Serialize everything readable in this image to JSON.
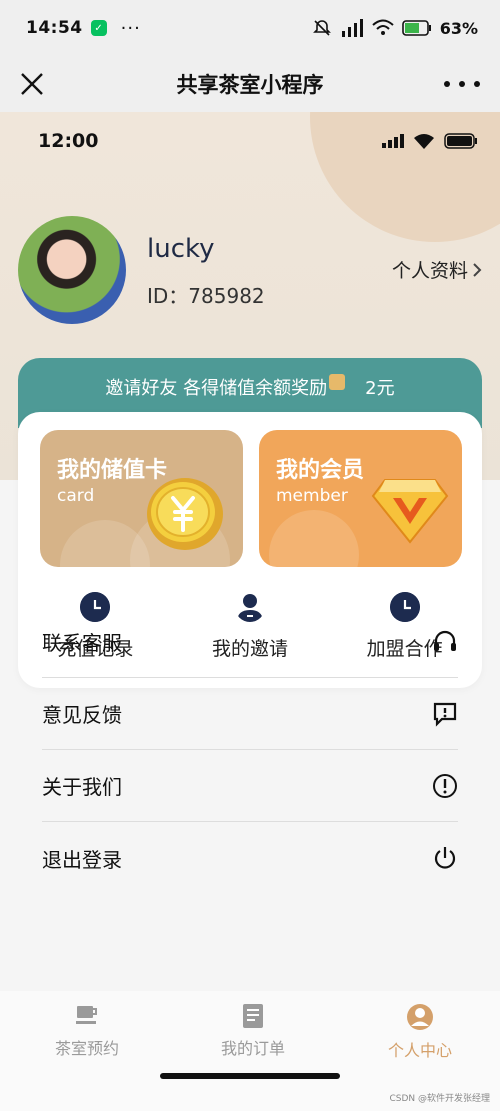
{
  "status_bar": {
    "time": "14:54",
    "more": "···",
    "battery": "63%"
  },
  "nav": {
    "title": "共享茶室小程序"
  },
  "inner_status": {
    "time": "12:00"
  },
  "profile": {
    "username": "lucky",
    "id_text": "ID：785982",
    "link_label": "个人资料"
  },
  "invite": {
    "text_1": "邀请好友 各得储值余额奖励",
    "text_2": "2元"
  },
  "cards": [
    {
      "title": "我的储值卡",
      "subtitle": "card",
      "color": "#d6b388"
    },
    {
      "title": "我的会员",
      "subtitle": "member",
      "color": "#f1a65a"
    }
  ],
  "quick_actions": [
    {
      "label": "充值记录",
      "icon": "clock-icon"
    },
    {
      "label": "我的邀请",
      "icon": "person-icon"
    },
    {
      "label": "加盟合作",
      "icon": "clock-icon"
    }
  ],
  "menu": [
    {
      "label": "联系客服",
      "icon": "headset-icon"
    },
    {
      "label": "意见反馈",
      "icon": "feedback-icon"
    },
    {
      "label": "关于我们",
      "icon": "info-icon"
    },
    {
      "label": "退出登录",
      "icon": "power-icon"
    }
  ],
  "tabs": [
    {
      "label": "茶室预约",
      "icon": "teacup-icon",
      "active": false
    },
    {
      "label": "我的订单",
      "icon": "order-icon",
      "active": false
    },
    {
      "label": "个人中心",
      "icon": "person-icon",
      "active": true
    }
  ],
  "watermark": "CSDN @软件开发张经理",
  "colors": {
    "accent": "#d4a06a",
    "banner": "#4e9a96",
    "navy_icon": "#1d2b4f"
  }
}
